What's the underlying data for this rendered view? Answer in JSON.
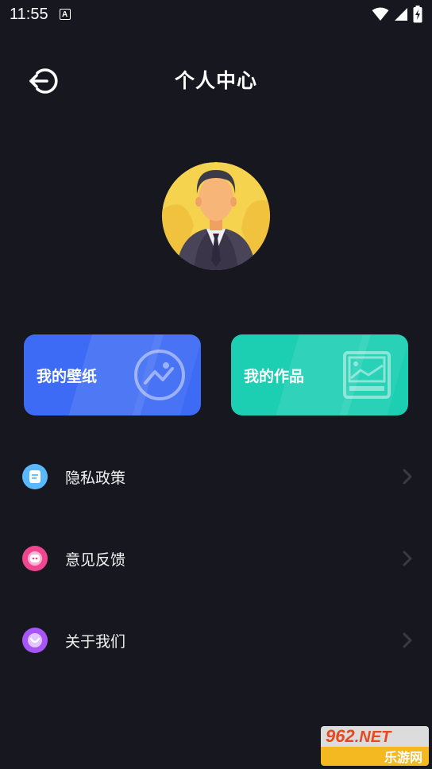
{
  "status_bar": {
    "time": "11:55",
    "notification_icon_text": "A",
    "icons": [
      "wifi-icon",
      "signal-icon",
      "battery-charging-icon"
    ]
  },
  "header": {
    "back_icon": "back-arrow-icon",
    "title": "个人中心"
  },
  "avatar": {
    "icon": "businessman-avatar"
  },
  "cards": {
    "wallpaper": {
      "label": "我的壁纸",
      "icon": "image-circle-icon",
      "color": "#3e6bf5"
    },
    "works": {
      "label": "我的作品",
      "icon": "picture-frame-icon",
      "color": "#1ccfb2"
    }
  },
  "menu": [
    {
      "label": "隐私政策",
      "icon": "document-icon",
      "color": "#5ab8ff"
    },
    {
      "label": "意见反馈",
      "icon": "chat-face-icon",
      "color": "#f0468f"
    },
    {
      "label": "关于我们",
      "icon": "smile-face-icon",
      "color": "#a855f7"
    }
  ],
  "watermark": {
    "number": "962",
    "net": ".NET",
    "subtitle": "乐游网"
  }
}
